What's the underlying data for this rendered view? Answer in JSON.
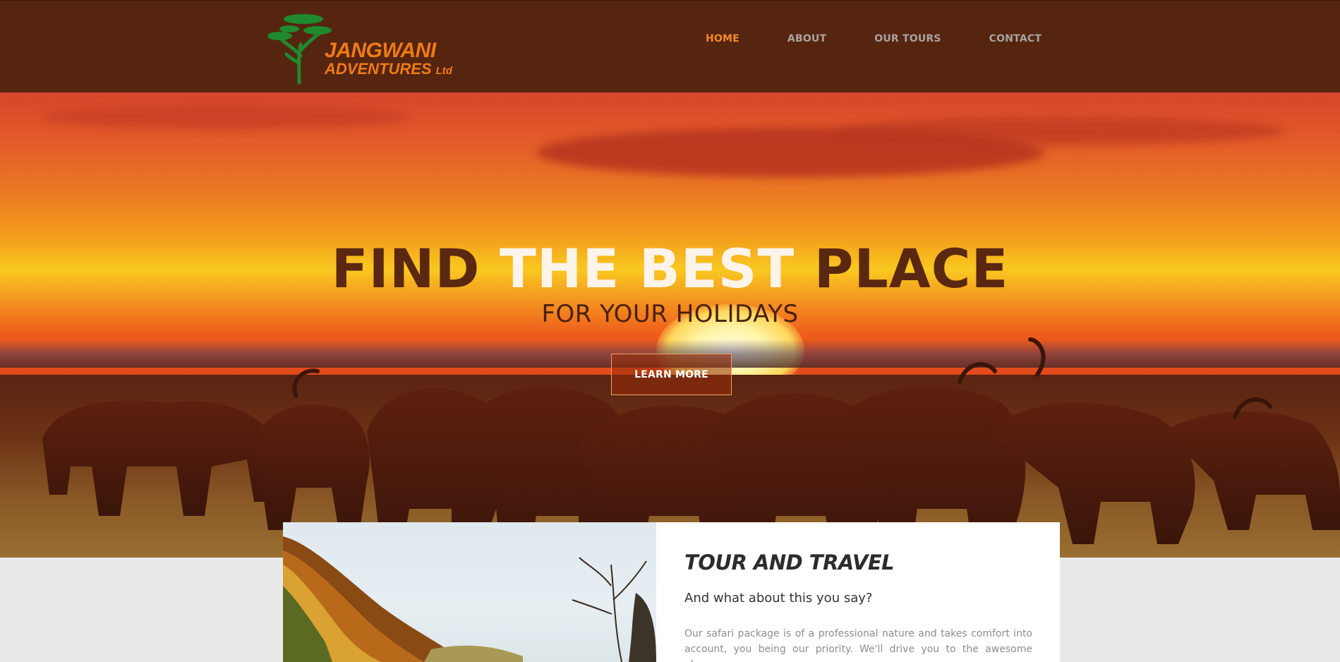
{
  "brand": {
    "line1": "JANGWANI",
    "line2": "ADVENTURES",
    "suffix": "Ltd",
    "color_text": "#f07a16",
    "color_tree": "#1f8a2e"
  },
  "nav": {
    "items": [
      {
        "label": "HOME",
        "active": true
      },
      {
        "label": "ABOUT",
        "active": false
      },
      {
        "label": "OUR TOURS",
        "active": false
      },
      {
        "label": "CONTACT",
        "active": false
      }
    ],
    "active_color": "#f4892a",
    "color": "#a9a39f"
  },
  "hero": {
    "title_word1": "FIND",
    "title_word2": "THE",
    "title_word3": "BEST",
    "title_word4": "PLACE",
    "subtitle_part1": "FOR YOUR",
    "subtitle_part2": "HOLIDAYS",
    "button_label": "LEARN MORE"
  },
  "about": {
    "title": "TOUR AND TRAVEL",
    "subtitle": "And what about this you say?",
    "body": "Our safari package is of a professional nature and takes comfort into account, you being our priority. We'll drive you to the awesome places"
  },
  "colors": {
    "header_bg": "#552510",
    "page_bg": "#e9e9e9"
  }
}
